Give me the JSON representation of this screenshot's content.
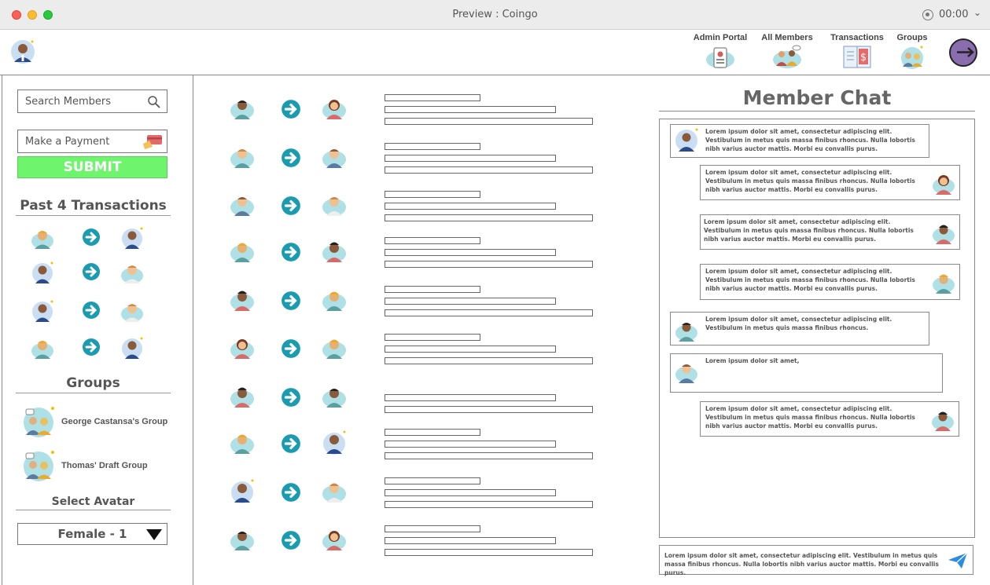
{
  "window": {
    "title": "Preview : Coingo",
    "recording_time": "00:00"
  },
  "header": {
    "nav": [
      {
        "label": "Admin Portal",
        "icon": "admin-badge-icon"
      },
      {
        "label": "All Members",
        "icon": "members-icon"
      },
      {
        "label": "Transactions",
        "icon": "transactions-ledger-icon"
      },
      {
        "label": "Groups",
        "icon": "groups-icon"
      }
    ],
    "logout_icon": "logout-icon"
  },
  "sidebar": {
    "search_placeholder": "Search Members",
    "payment_placeholder": "Make a Payment",
    "submit_label": "SUBMIT",
    "submit_color": "#6ff56d",
    "past_title": "Past 4 Transactions",
    "groups_title": "Groups",
    "groups": [
      {
        "name": "George Castansa's Group"
      },
      {
        "name": "Thomas' Draft Group"
      }
    ],
    "select_title": "Select Avatar",
    "select_value": "Female - 1"
  },
  "chat": {
    "title": "Member Chat",
    "messages": [
      {
        "side": "left",
        "text": "Lorem ipsum dolor sit amet, consectetur adipiscing elit. Vestibulum in metus quis massa finibus rhoncus. Nulla lobortis nibh varius auctor mattis. Morbi eu convallis purus."
      },
      {
        "side": "right",
        "text": "Lorem ipsum dolor sit amet, consectetur adipiscing elit. Vestibulum in metus quis massa finibus rhoncus. Nulla lobortis nibh varius auctor mattis. Morbi eu convallis purus."
      },
      {
        "side": "right",
        "text": "Lorem ipsum dolor sit amet, consectetur adipiscing elit. Vestibulum in metus quis massa finibus rhoncus. Nulla lobortis nibh varius auctor mattis. Morbi eu convallis purus."
      },
      {
        "side": "right",
        "text": "Lorem ipsum dolor sit amet, consectetur adipiscing elit. Vestibulum in metus quis massa finibus rhoncus. Nulla lobortis nibh varius auctor mattis. Morbi eu convallis purus."
      },
      {
        "side": "left",
        "text": "Lorem ipsum dolor sit amet, consectetur adipiscing elit. Vestibulum in metus quis massa finibus rhoncus."
      },
      {
        "side": "left",
        "text": "Lorem ipsum dolor sit amet,"
      },
      {
        "side": "right",
        "text": "Lorem ipsum dolor sit amet, consectetur adipiscing elit. Vestibulum in metus quis massa finibus rhoncus. Nulla lobortis nibh varius auctor mattis. Morbi eu convallis purus."
      }
    ],
    "input_text": "Lorem ipsum dolor sit amet, consectetur adipiscing elit. Vestibulum in metus quis massa finibus rhoncus. Nulla lobortis nibh varius auctor mattis. Morbi eu convallis purus."
  },
  "colors": {
    "arrow": "#1b9bb0",
    "avatar_bg": "#aee0e6"
  }
}
